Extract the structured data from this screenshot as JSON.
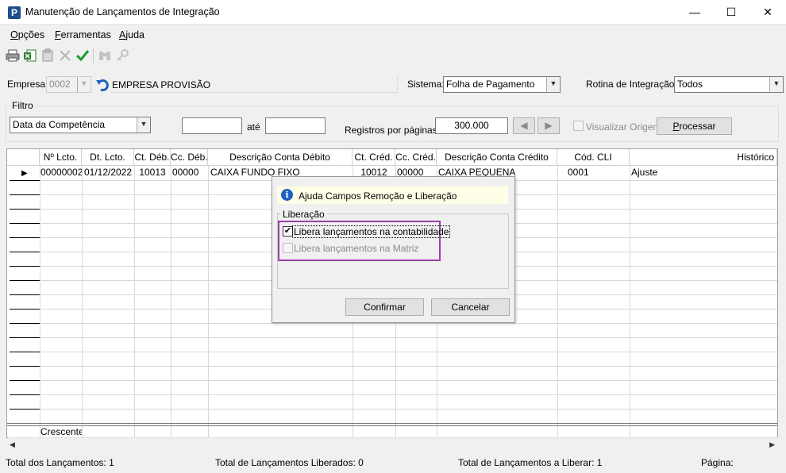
{
  "window": {
    "title": "Manutenção de Lançamentos de Integração",
    "app_icon": "P",
    "controls": {
      "minimize": "—",
      "maximize": "☐",
      "close": "✕"
    }
  },
  "menu": [
    {
      "label": "Opções",
      "accel": "O"
    },
    {
      "label": "Ferramentas",
      "accel": "F"
    },
    {
      "label": "Ajuda",
      "accel": "A"
    }
  ],
  "toolbar": {
    "icons": [
      "printer-icon",
      "excel-export-icon",
      "clipboard-icon",
      "delete-icon",
      "confirm-check-icon",
      "binoculars-icon",
      "key-icon"
    ]
  },
  "empresa": {
    "label": "Empresa:",
    "code": "0002",
    "name": "EMPRESA PROVISÃO"
  },
  "sistema": {
    "label": "Sistema:",
    "value": "Folha de Pagamento"
  },
  "rotina": {
    "label": "Rotina de Integração:",
    "value": "Todos"
  },
  "filtro": {
    "title": "Filtro",
    "date_type": "Data da Competência",
    "from": "",
    "to_label": "até",
    "to": "",
    "registros_label": "Registros por páginas:",
    "registros_value": "300.000",
    "visualizar_origem": "Visualizar Origem",
    "processar": "Processar"
  },
  "grid": {
    "columns": [
      "Nº Lcto.",
      "Dt. Lcto.",
      "Ct. Déb.",
      "Cc. Déb.",
      "Descrição Conta Débito",
      "Ct. Créd.",
      "Cc. Créd.",
      "Descrição Conta Crédito",
      "Cód. CLI",
      "Histórico"
    ],
    "rows": [
      [
        "00000002",
        "01/12/2022",
        "10013",
        "00000",
        "CAIXA FUNDO FIXO",
        "10012",
        "00000",
        "CAIXA PEQUENA",
        "0001",
        "Ajuste"
      ]
    ],
    "footer": "Crescente"
  },
  "status": {
    "total_lancamentos": "Total dos Lançamentos: 1",
    "total_liberados": "Total de Lançamentos Liberados: 0",
    "total_a_liberar": "Total de Lançamentos a Liberar: 1",
    "pagina": "Página:"
  },
  "dialog": {
    "header": "Ajuda Campos Remoção e Liberação",
    "group_title": "Liberação",
    "option1": {
      "label": "Libera lançamentos na contabilidade",
      "checked": true
    },
    "option2": {
      "label": "Libera lançamentos na Matriz",
      "checked": false
    },
    "confirm": "Confirmar",
    "cancel": "Cancelar"
  },
  "colors": {
    "highlight": "#9b3fa8",
    "info_icon": "#1f5fc0",
    "dialog_header_bg": "#ffffe8"
  }
}
